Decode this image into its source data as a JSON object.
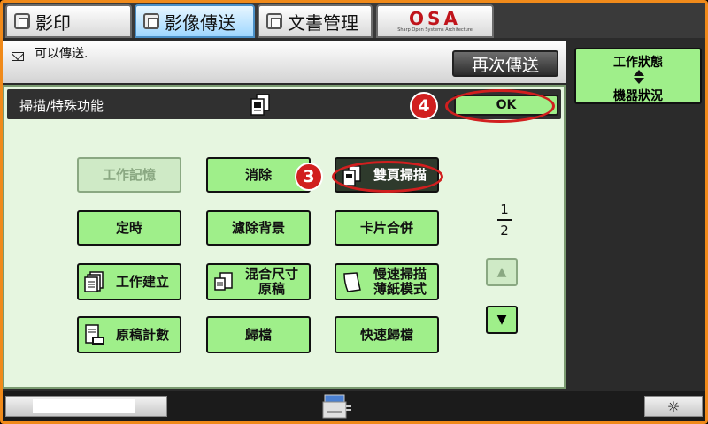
{
  "tabs": [
    {
      "label": "影印",
      "icon": "copy-icon",
      "active": false
    },
    {
      "label": "影像傳送",
      "icon": "image-send-icon",
      "active": true
    },
    {
      "label": "文書管理",
      "icon": "document-filing-icon",
      "active": false
    }
  ],
  "osa": {
    "logo": "OSA",
    "tagline": "Sharp Open Systems Architecture"
  },
  "message": {
    "text": "可以傳送.",
    "icon": "mail-icon"
  },
  "resend_label": "再次傳送",
  "panel": {
    "title": "掃描/特殊功能",
    "ok_label": "OK"
  },
  "buttons": {
    "job_memory": "工作記憶",
    "erase": "消除",
    "duplex_scan": "雙頁掃描",
    "timer": "定時",
    "suppress_background": "濾除背景",
    "card_shot": "卡片合併",
    "job_build": "工作建立",
    "mixed_size_line1": "混合尺寸",
    "mixed_size_line2": "原稿",
    "slow_scan_line1": "慢速掃描",
    "slow_scan_line2": "薄紙模式",
    "original_count": "原稿計數",
    "file": "歸檔",
    "quick_file": "快速歸檔"
  },
  "pager": {
    "current": "1",
    "total": "2"
  },
  "status": {
    "line1": "工作狀態",
    "line2": "機器狀況"
  },
  "annotations": {
    "marker_ok": "4",
    "marker_duplex": "3"
  },
  "colors": {
    "accent_green": "#9fef8a",
    "frame_orange": "#f08a1a",
    "annotation_red": "#d11f1f",
    "active_tab": "#9fd7ff"
  }
}
